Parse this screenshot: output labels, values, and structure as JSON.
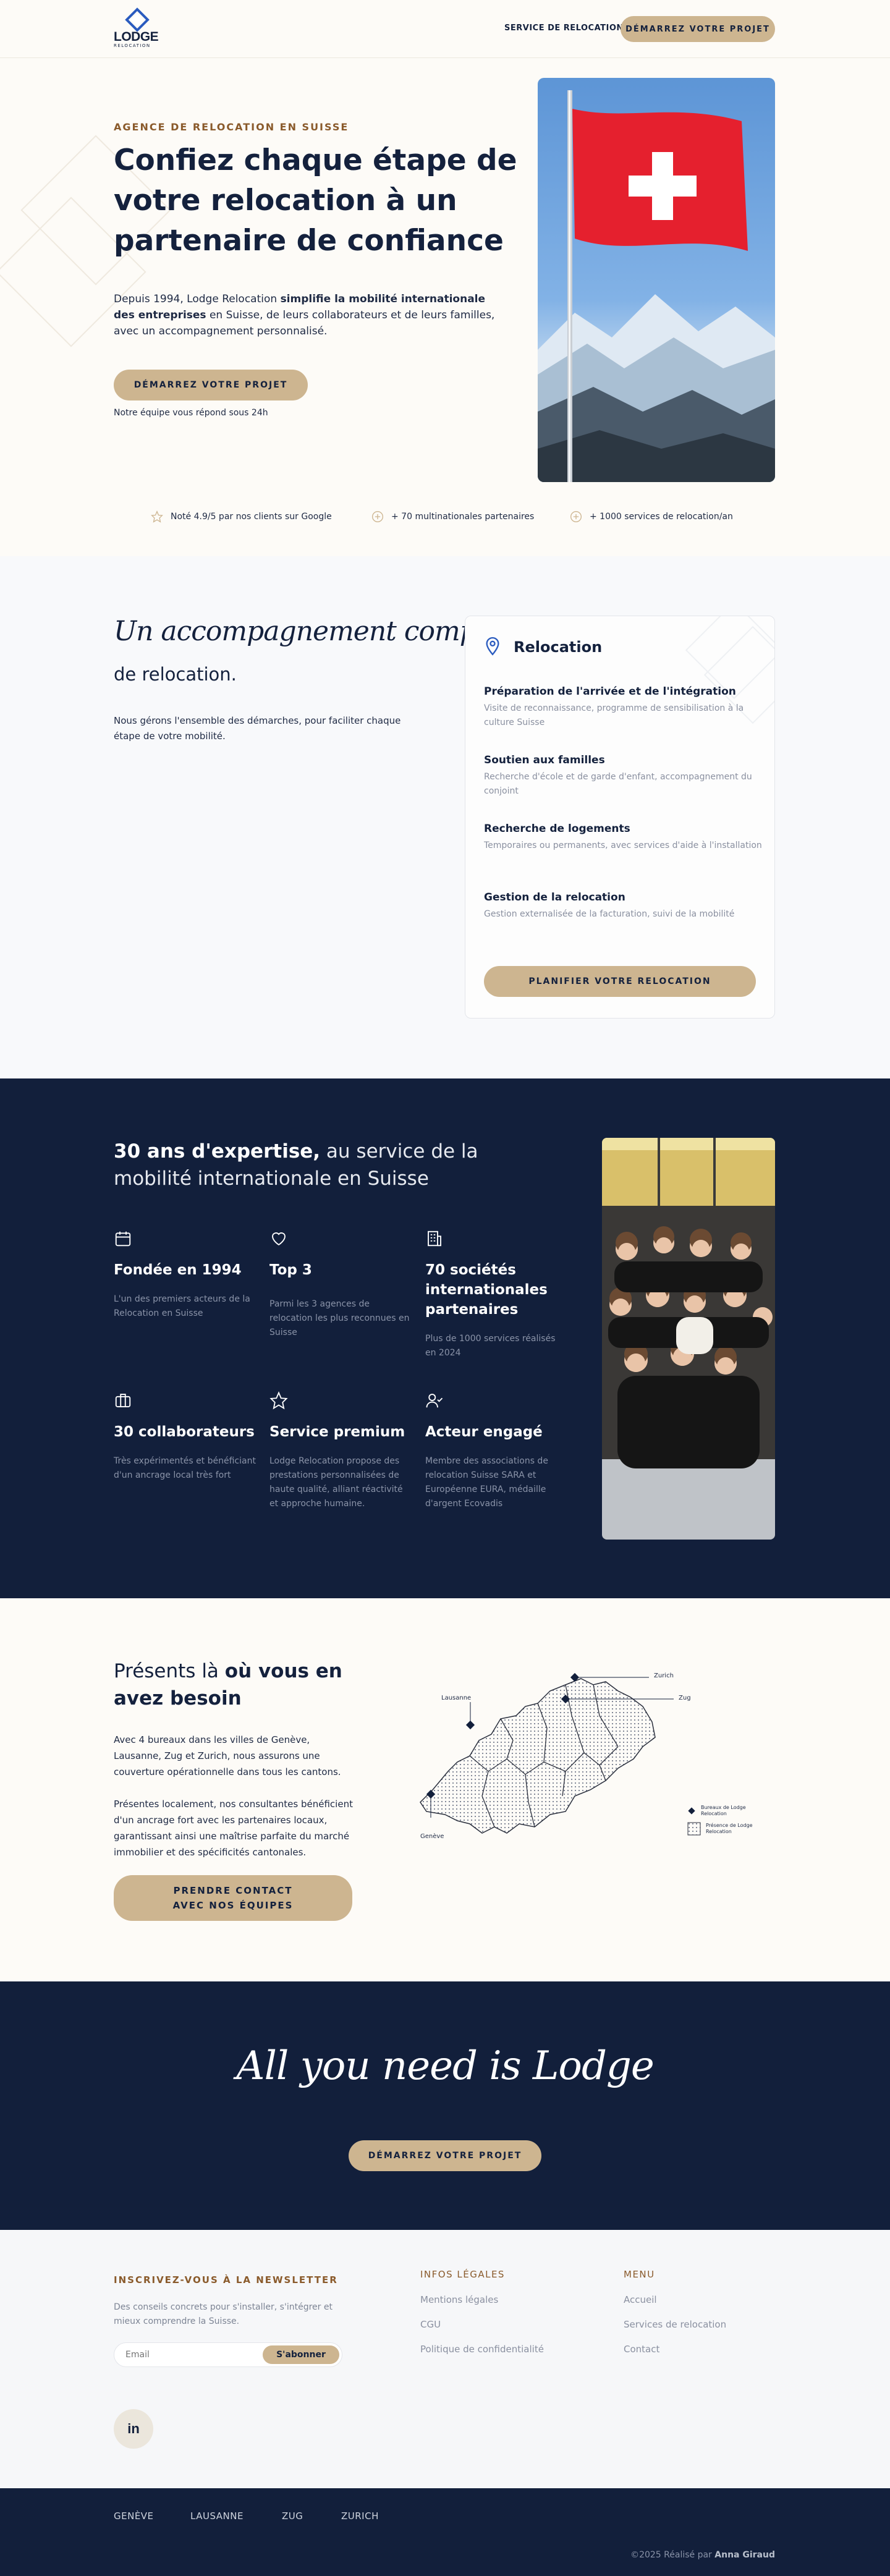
{
  "header": {
    "logo_text": "LODGE",
    "logo_sub": "RELOCATION",
    "nav_link": "SERVICE DE RELOCATION",
    "cta": "DÉMARREZ VOTRE PROJET"
  },
  "hero": {
    "eyebrow": "AGENCE DE RELOCATION EN SUISSE",
    "title_line1": "Confiez chaque étape de",
    "title_line2": "votre relocation à un",
    "title_line3": "partenaire de confiance",
    "desc_part1": "Depuis 1994, Lodge Relocation ",
    "desc_bold": "simplifie la mobilité internationale des entreprises",
    "desc_part2": " en Suisse, de leurs collaborateurs et de leurs familles, avec un accompagnement personnalisé.",
    "cta": "DÉMARREZ VOTRE PROJET",
    "note": "Notre équipe vous répond sous 24h",
    "badges": [
      "Noté 4.9/5 par nos clients sur Google",
      "+ 70 multinationales partenaires",
      "+ 1000 services de relocation/an"
    ]
  },
  "services": {
    "title_script": "Un accompagnement complet",
    "title_rest": "de relocation.",
    "desc": "Nous gérons l'ensemble des démarches, pour faciliter chaque étape de votre mobilité.",
    "card_title": "Relocation",
    "items": [
      {
        "title": "Préparation de l'arrivée et de l'intégration",
        "desc": "Visite de reconnaissance, programme de sensibilisation à la culture Suisse"
      },
      {
        "title": "Soutien aux familles",
        "desc": "Recherche d'école et de garde d'enfant, accompagnement du conjoint"
      },
      {
        "title": "Recherche de logements",
        "desc": "Temporaires ou permanents, avec services d'aide à l'installation"
      },
      {
        "title": "Gestion de la relocation",
        "desc": "Gestion externalisée de la facturation, suivi de la mobilité"
      }
    ],
    "card_cta": "PLANIFIER VOTRE RELOCATION"
  },
  "expertise": {
    "title_bold": "30 ans d'expertise,",
    "title_rest": " au service de la mobilité internationale en Suisse",
    "features": [
      {
        "icon": "calendar-icon",
        "title": "Fondée en 1994",
        "desc": "L'un des premiers acteurs de la Relocation en Suisse"
      },
      {
        "icon": "heart-icon",
        "title": "Top 3",
        "desc": "Parmi les 3 agences de relocation les plus reconnues en Suisse"
      },
      {
        "icon": "building-icon",
        "title": "70 sociétés internationales partenaires",
        "desc": "Plus de 1000 services réalisés en 2024"
      },
      {
        "icon": "briefcase-icon",
        "title": "30 collaborateurs",
        "desc": "Très expérimentés et bénéficiant d'un ancrage local très fort"
      },
      {
        "icon": "star-icon",
        "title": "Service premium",
        "desc": "Lodge Relocation propose des prestations personnalisées de haute qualité, alliant réactivité et approche humaine."
      },
      {
        "icon": "user-check-icon",
        "title": "Acteur engagé",
        "desc": "Membre des associations de relocation Suisse SARA et Européenne EURA, médaille d'argent Ecovadis"
      }
    ]
  },
  "presence": {
    "title_light": "Présents là ",
    "title_bold": "où vous en avez besoin",
    "p1": "Avec 4 bureaux dans les villes de Genève, Lausanne, Zug et Zurich, nous assurons une couverture opérationnelle dans tous les cantons.",
    "p2": "Présentes localement, nos consultantes bénéficient d'un ancrage fort avec les partenaires locaux, garantissant ainsi une maîtrise parfaite du marché immobilier et des spécificités cantonales.",
    "cta_line1": "PRENDRE CONTACT",
    "cta_line2": "AVEC NOS ÉQUIPES",
    "map_labels": [
      "Zurich",
      "Zug",
      "Lausanne",
      "Genève"
    ],
    "legend": [
      "Bureaux de Lodge Relocation",
      "Présence de Lodge Relocation"
    ]
  },
  "cta_band": {
    "script": "All you need is Lodge",
    "cta": "DÉMARREZ VOTRE PROJET"
  },
  "footer": {
    "newsletter_title": "INSCRIVEZ-VOUS À LA NEWSLETTER",
    "newsletter_desc": "Des conseils concrets pour s'installer, s'intégrer et mieux comprendre la Suisse.",
    "email_placeholder": "Email",
    "subscribe": "S'abonner",
    "legal_title": "INFOS LÉGALES",
    "legal_links": [
      "Mentions légales",
      "CGU",
      "Politique de confidentialité"
    ],
    "menu_title": "MENU",
    "menu_links": [
      "Accueil",
      "Services de relocation",
      "Contact"
    ],
    "linkedin": "in",
    "cities": [
      "GENÈVE",
      "LAUSANNE",
      "ZUG",
      "ZURICH"
    ],
    "credit_prefix": "©2025 Réalisé par ",
    "credit_name": "Anna Giraud"
  },
  "colors": {
    "navy": "#121f3b",
    "gold": "#cdb590",
    "cream": "#fdfbf7",
    "eyebrow": "#8a5a2b"
  }
}
